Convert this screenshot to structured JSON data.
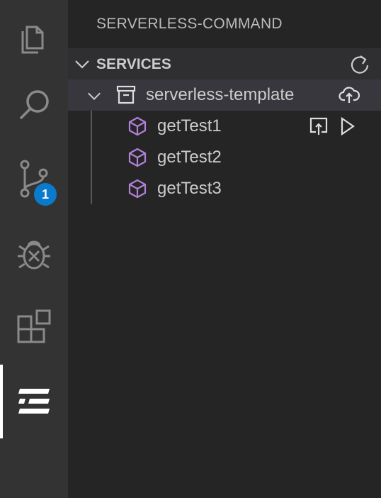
{
  "activity_bar": {
    "items": [
      {
        "icon": "explorer-icon"
      },
      {
        "icon": "search-icon"
      },
      {
        "icon": "source-control-icon",
        "badge": "1"
      },
      {
        "icon": "debug-icon"
      },
      {
        "icon": "extensions-icon"
      },
      {
        "icon": "serverless-icon",
        "active": true
      }
    ],
    "badge_color": "#0a7acc"
  },
  "sidebar": {
    "title": "SERVERLESS-COMMAND",
    "section": {
      "title": "SERVICES",
      "service": {
        "name": "serverless-template",
        "functions": [
          {
            "name": "getTest1"
          },
          {
            "name": "getTest2"
          },
          {
            "name": "getTest3"
          }
        ]
      }
    }
  },
  "colors": {
    "activity_bg": "#333333",
    "sidebar_bg": "#252526",
    "icon_purple": "#b180d7",
    "text": "#cccccc"
  }
}
